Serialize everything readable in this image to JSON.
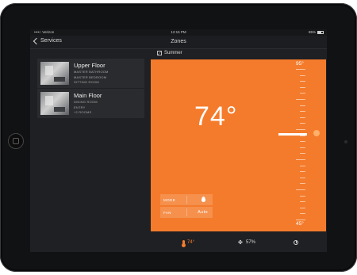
{
  "status_bar": {
    "carrier": "••••○ Verizon",
    "time": "12:15 PM",
    "battery": "85%"
  },
  "nav": {
    "back_label": "Services",
    "title": "Zones"
  },
  "zones": [
    {
      "name": "Upper Floor",
      "rooms": [
        "MASTER BATHROOM",
        "MASTER BEDROOM",
        "SITTING ROOM"
      ]
    },
    {
      "name": "Main Floor",
      "rooms": [
        "DINING ROOM",
        "ENTRY",
        "+2 ROOMS"
      ]
    }
  ],
  "scene": {
    "label": "Summer"
  },
  "thermostat": {
    "setpoint": "74°",
    "scale_max": "95°",
    "scale_min": "45°",
    "mode_label": "MODE",
    "fan_label": "FAN",
    "fan_value": "Auto",
    "accent_color": "#f47b2b"
  },
  "tabs": {
    "temperature": "74°",
    "humidity": "57%"
  }
}
